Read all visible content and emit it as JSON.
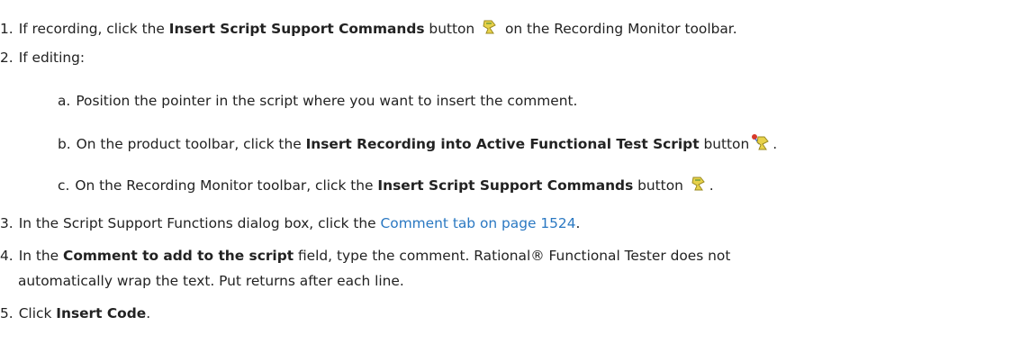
{
  "steps": [
    {
      "num": "1.",
      "before": "If recording, click the ",
      "bold": "Insert Script Support Commands",
      "after": " button ",
      "after_icon": " on the Recording Monitor toolbar.",
      "icon": "script-support-icon"
    },
    {
      "num": "2.",
      "text": "If editing:",
      "substeps": [
        {
          "num": "a.",
          "text": "Position the pointer in the script where you want to insert the comment."
        },
        {
          "num": "b.",
          "before": "On the product toolbar, click the ",
          "bold": "Insert Recording into Active Functional Test Script",
          "after": " button",
          "after_icon": ".",
          "icon": "insert-recording-icon"
        },
        {
          "num": "c.",
          "before": "On the Recording Monitor toolbar, click the ",
          "bold": "Insert Script Support Commands",
          "after": " button ",
          "after_icon": ".",
          "icon": "script-support-icon"
        }
      ]
    },
    {
      "num": "3.",
      "before": "In the Script Support Functions dialog box, click the ",
      "link": "Comment tab on page 1524",
      "after": "."
    },
    {
      "num": "4.",
      "before": "In the ",
      "bold": "Comment to add to the script",
      "after": " field, type the comment. Rational® Functional Tester does not",
      "continuation": "automatically wrap the text. Put returns after each line."
    },
    {
      "num": "5.",
      "before": "Click ",
      "bold": "Insert Code",
      "after": "."
    }
  ],
  "colors": {
    "link": "#2a78c2",
    "text": "#222222",
    "icon_yellow": "#e8d24a"
  }
}
